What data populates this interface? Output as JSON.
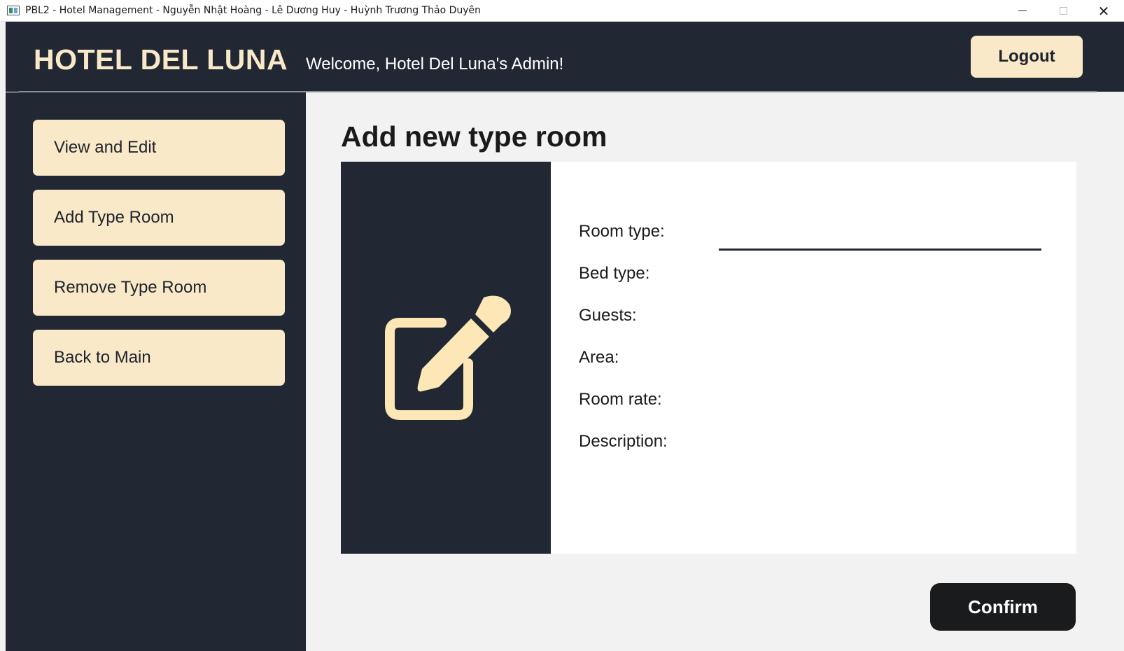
{
  "window": {
    "title": "PBL2 - Hotel Management - Nguyễn Nhật Hoàng - Lê Dương Huy - Huỳnh Trương Thảo Duyên"
  },
  "header": {
    "brand": "HOTEL DEL LUNA",
    "welcome": "Welcome, Hotel Del Luna's Admin!",
    "logout_label": "Logout"
  },
  "sidebar": {
    "items": [
      {
        "label": "View and Edit"
      },
      {
        "label": "Add Type Room"
      },
      {
        "label": "Remove Type Room"
      },
      {
        "label": "Back to Main"
      }
    ]
  },
  "main": {
    "title": "Add new type room",
    "form": {
      "labels": [
        {
          "label": "Room type:"
        },
        {
          "label": "Bed type:"
        },
        {
          "label": "Guests:"
        },
        {
          "label": "Area:"
        },
        {
          "label": "Room rate:"
        },
        {
          "label": "Description:"
        }
      ],
      "room_type_value": "",
      "bed_type_value": "",
      "guests_value": "",
      "area_value": "",
      "room_rate_value": "",
      "description_value": ""
    },
    "confirm_label": "Confirm"
  },
  "icons": {
    "app": "app-window-icon",
    "illustration": "edit-note-icon"
  },
  "colors": {
    "dark_panel": "#222833",
    "accent_cream": "#fae9c8",
    "icon_cream": "#fde7b6",
    "page_background": "#f2f2f2",
    "confirm_button": "#1a1b1d"
  }
}
